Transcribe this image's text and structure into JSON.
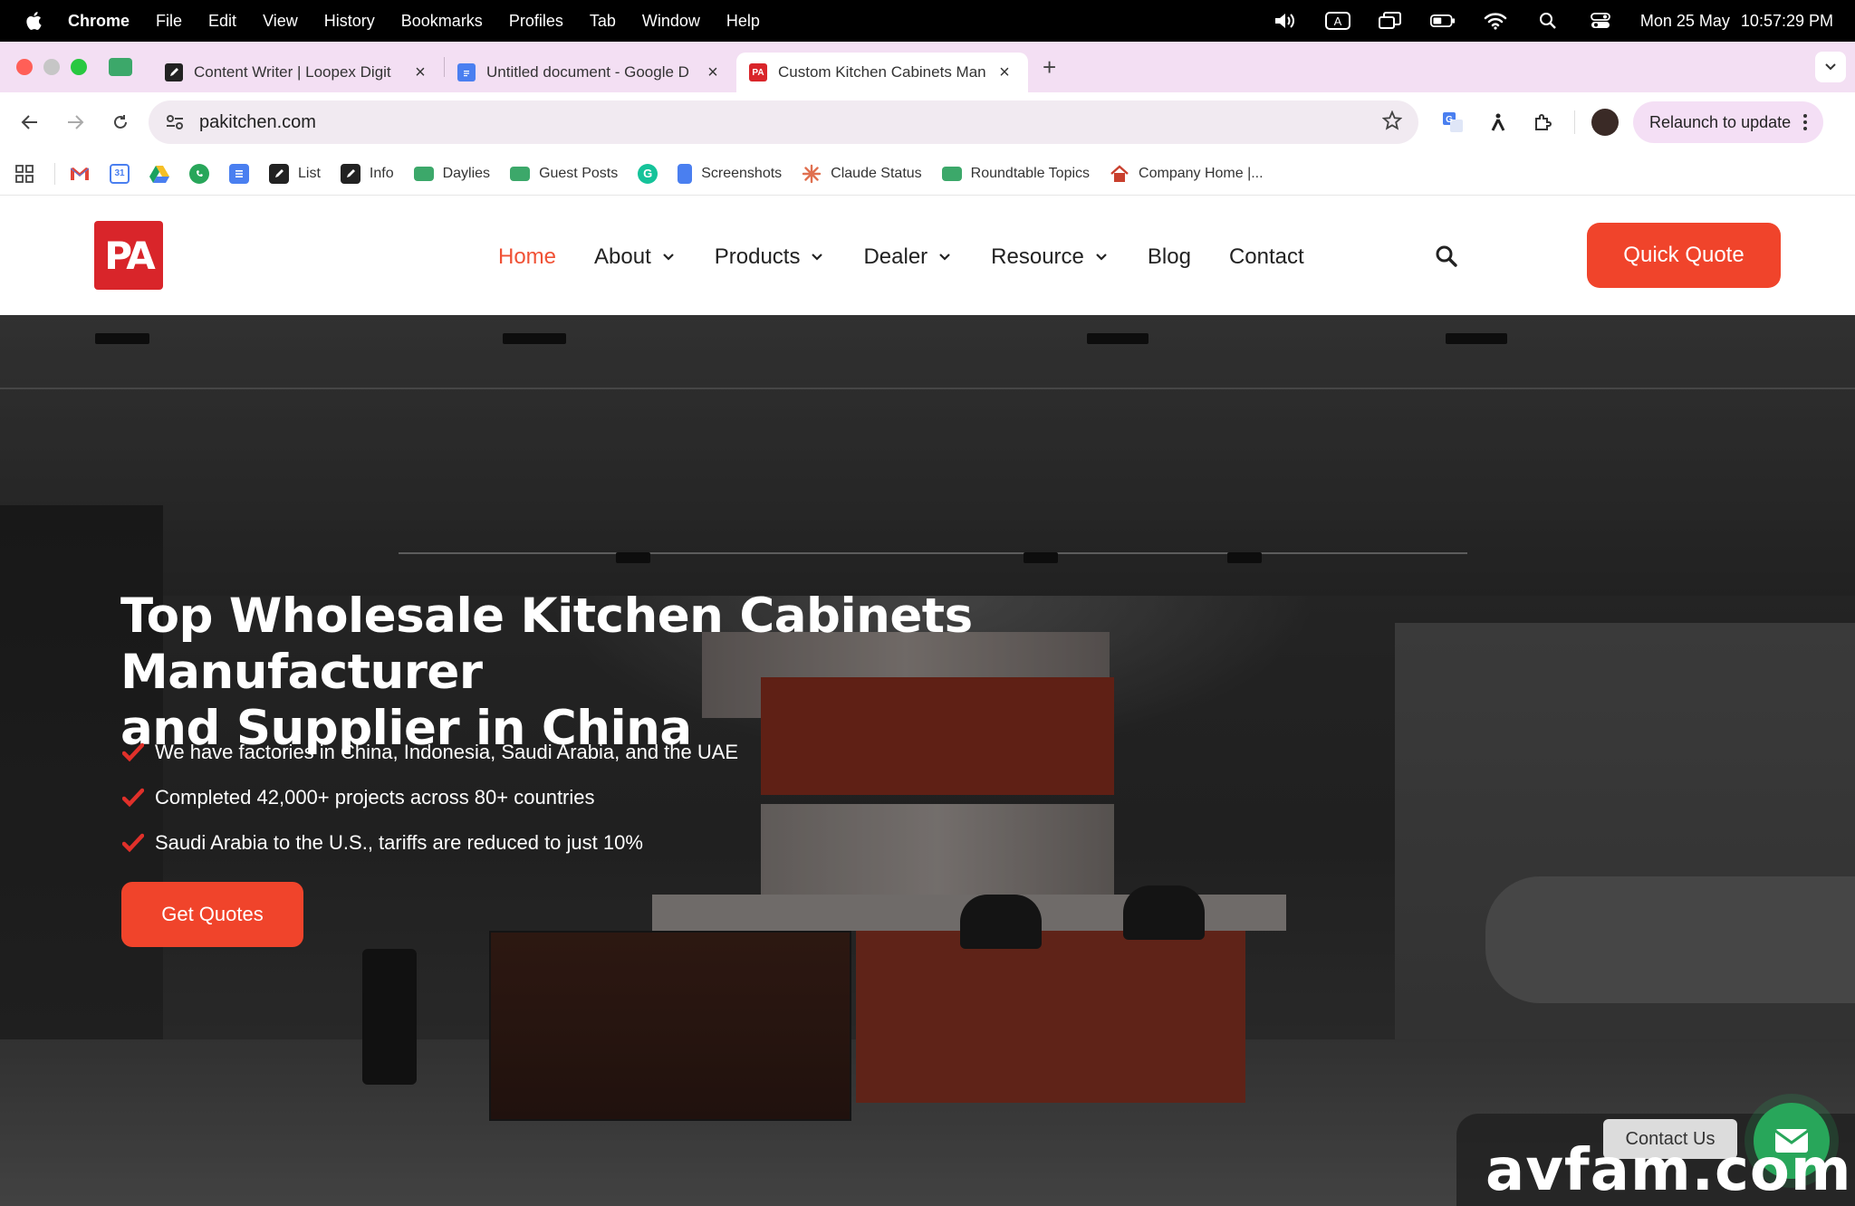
{
  "menubar": {
    "app": "Chrome",
    "items": [
      "File",
      "Edit",
      "View",
      "History",
      "Bookmarks",
      "Profiles",
      "Tab",
      "Window",
      "Help"
    ],
    "date": "Mon 25 May",
    "time": "10:57:29 PM"
  },
  "tabs": [
    {
      "title": "Content Writer | Loopex Digit",
      "active": false,
      "favicon": "pen-icon"
    },
    {
      "title": "Untitled document - Google D",
      "active": false,
      "favicon": "google-docs-icon"
    },
    {
      "title": "Custom Kitchen Cabinets Man",
      "active": true,
      "favicon": "pa-logo-icon"
    }
  ],
  "toolbar": {
    "url": "pakitchen.com",
    "relaunch_label": "Relaunch to update"
  },
  "bookmarks": [
    {
      "label": "",
      "icon": "gmail-icon"
    },
    {
      "label": "",
      "icon": "calendar-icon"
    },
    {
      "label": "",
      "icon": "drive-icon"
    },
    {
      "label": "",
      "icon": "whatsapp-icon"
    },
    {
      "label": "",
      "icon": "forms-icon"
    },
    {
      "label": "List",
      "icon": "pen-icon"
    },
    {
      "label": "Info",
      "icon": "pen-icon"
    },
    {
      "label": "Daylies",
      "icon": "folder-icon"
    },
    {
      "label": "Guest Posts",
      "icon": "folder-icon"
    },
    {
      "label": "",
      "icon": "grammarly-icon"
    },
    {
      "label": "Screenshots",
      "icon": "google-docs-icon"
    },
    {
      "label": "Claude Status",
      "icon": "claude-icon"
    },
    {
      "label": "Roundtable Topics",
      "icon": "folder-icon"
    },
    {
      "label": "Company Home |...",
      "icon": "home-icon"
    }
  ],
  "site": {
    "logo_text": "PA",
    "nav": [
      {
        "label": "Home",
        "active": true,
        "dropdown": false
      },
      {
        "label": "About",
        "active": false,
        "dropdown": true
      },
      {
        "label": "Products",
        "active": false,
        "dropdown": true
      },
      {
        "label": "Dealer",
        "active": false,
        "dropdown": true
      },
      {
        "label": "Resource",
        "active": false,
        "dropdown": true
      },
      {
        "label": "Blog",
        "active": false,
        "dropdown": false
      },
      {
        "label": "Contact",
        "active": false,
        "dropdown": false
      }
    ],
    "quote_button": "Quick Quote"
  },
  "hero": {
    "title_line1": "Top Wholesale Kitchen Cabinets Manufacturer",
    "title_line2": "and Supplier in China",
    "bullets": [
      "We have factories in China, Indonesia, Saudi Arabia, and the UAE",
      "Completed 42,000+ projects across 80+ countries",
      "Saudi Arabia to the U.S., tariffs are reduced to just 10%"
    ],
    "cta": "Get Quotes"
  },
  "contact_widget": {
    "label": "Contact Us"
  },
  "watermark": "avfam.com",
  "colors": {
    "accent": "#f0442b",
    "brand_red": "#d9252a",
    "tab_strip": "#f3dff3",
    "whatsapp_green": "#28a65a"
  }
}
